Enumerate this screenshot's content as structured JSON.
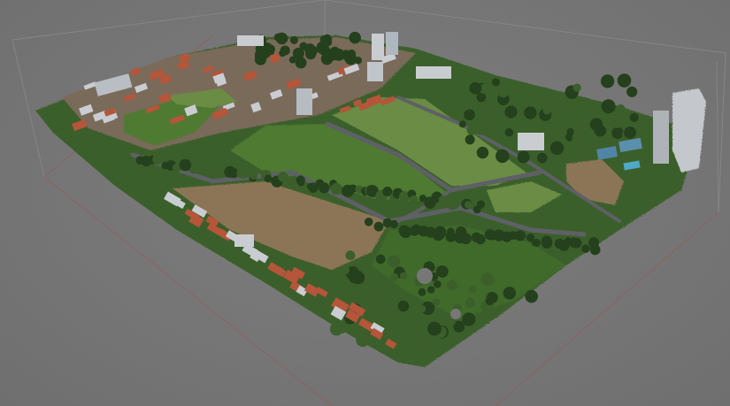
{
  "viewer": {
    "background_color": "#777777",
    "bbox_top_color": "#8a8a8a",
    "bbox_bottom_color": "#9a5a5a",
    "ground_plane_color": "#a06060"
  },
  "model": {
    "type": "photogrammetry-point-cloud",
    "colors": {
      "lawn": "#4f7a33",
      "lawn_light": "#6a8c45",
      "dry_field": "#8c7456",
      "tree_dark": "#24401c",
      "tree": "#3b5e2a",
      "road": "#5e6066",
      "roof_red": "#b5553a",
      "building_white": "#c9cdd2",
      "pool": "#4fa8c8"
    }
  }
}
